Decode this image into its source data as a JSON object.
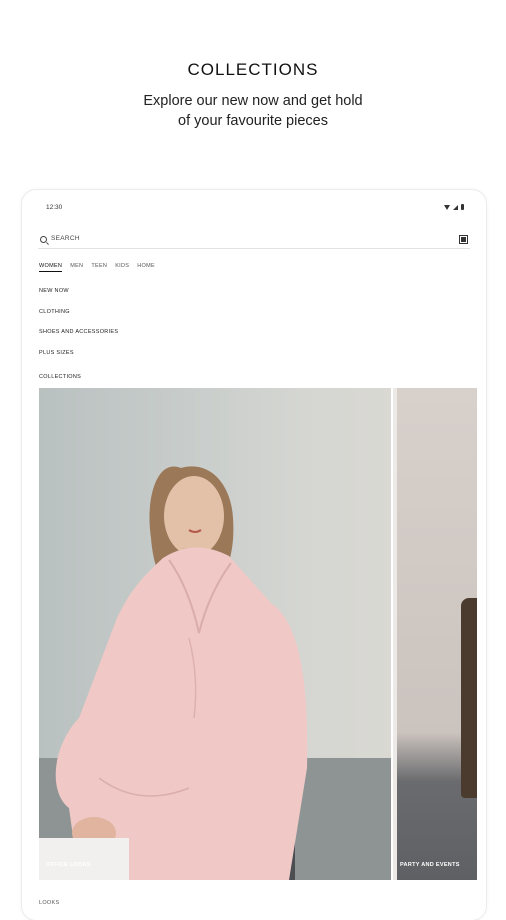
{
  "promo": {
    "title": "COLLECTIONS",
    "subtitle_line1": "Explore our new now and get hold",
    "subtitle_line2": "of your favourite pieces"
  },
  "status_bar": {
    "time": "12:30",
    "icons": [
      "wifi-icon",
      "signal-icon",
      "battery-icon"
    ]
  },
  "search": {
    "placeholder": "SEARCH",
    "icon": "search-icon",
    "scan_icon": "barcode-scan-icon"
  },
  "tabs": [
    {
      "label": "WOMEN",
      "active": true
    },
    {
      "label": "MEN",
      "active": false
    },
    {
      "label": "TEEN",
      "active": false
    },
    {
      "label": "KIDS",
      "active": false
    },
    {
      "label": "HOME",
      "active": false
    }
  ],
  "menu": {
    "items": [
      {
        "label": "NEW NOW"
      },
      {
        "label": "CLOTHING"
      },
      {
        "label": "SHOES AND ACCESSORIES"
      },
      {
        "label": "PLUS SIZES"
      }
    ]
  },
  "collections": {
    "section_label": "COLLECTIONS",
    "cards": [
      {
        "label": "OFFICE LOOKS"
      },
      {
        "label": "PARTY AND EVENTS"
      }
    ]
  },
  "bottom": {
    "label": "LOOKS"
  },
  "colors": {
    "accent": "#111111",
    "background": "#ffffff"
  }
}
